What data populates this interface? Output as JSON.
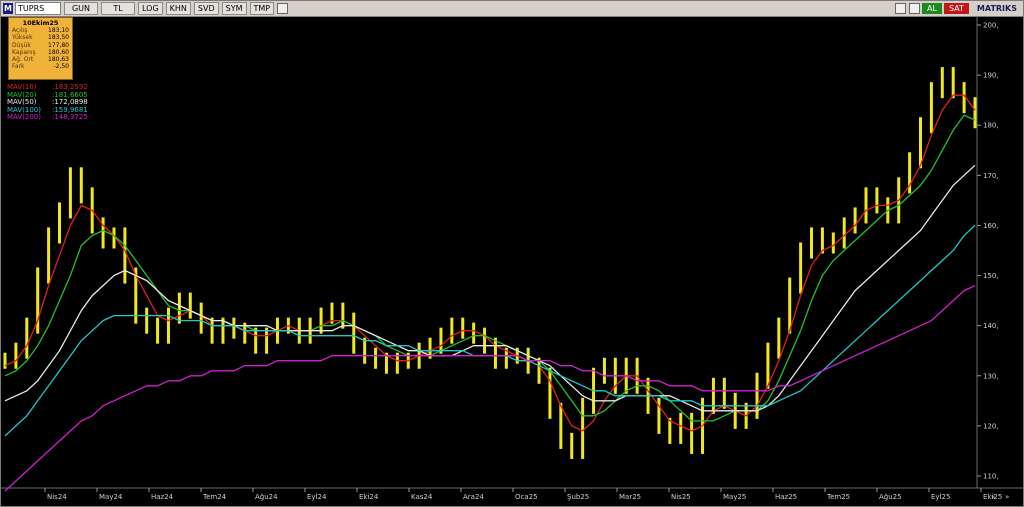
{
  "toolbar": {
    "logo": "M",
    "symbol": "TUPRS",
    "buttons": [
      "GUN",
      "TL",
      "LOG",
      "KHN",
      "SVD",
      "SYM",
      "TMP"
    ],
    "buy": "AL",
    "sell": "SAT",
    "brand": "MATRIKS"
  },
  "info": {
    "date": "10Ekim25",
    "rows": [
      {
        "label": "Açılış",
        "value": "183,10"
      },
      {
        "label": "Yüksek",
        "value": "183,50"
      },
      {
        "label": "Düşük",
        "value": "177,80"
      },
      {
        "label": "Kapanış",
        "value": "180,60"
      },
      {
        "label": "Ağ. Ort",
        "value": "180,63"
      },
      {
        "label": "Fark",
        "value": "-2,50"
      }
    ]
  },
  "mav": [
    {
      "label": "MAV(10)",
      "value": ":183,2592",
      "color": "#e02020"
    },
    {
      "label": "MAV(20)",
      "value": ":181,6605",
      "color": "#22c22a"
    },
    {
      "label": "MAV(50)",
      "value": ":172,0898",
      "color": "#e8e8e8"
    },
    {
      "label": "MAV(100)",
      "value": ":159,9681",
      "color": "#20c8c8"
    },
    {
      "label": "MAV(200)",
      "value": ":148,3725",
      "color": "#d020d0"
    }
  ],
  "chart_data": {
    "type": "line",
    "xticks": [
      "Nis24",
      "May24",
      "Haz24",
      "Tem24",
      "Ağu24",
      "Eyl24",
      "Eki24",
      "Kas24",
      "Ara24",
      "Oca25",
      "Şub25",
      "Mar25",
      "Nis25",
      "May25",
      "Haz25",
      "Tem25",
      "Ağu25",
      "Eyl25",
      "Eki25"
    ],
    "yticks": [
      "200,",
      "190,",
      "180,",
      "170,",
      "160,",
      "150,",
      "140,",
      "130,",
      "120,",
      "110,"
    ],
    "ylim": [
      108,
      201
    ],
    "price": [
      133,
      135,
      140,
      150,
      158,
      163,
      170,
      166,
      160,
      157,
      158,
      150,
      142,
      140,
      138,
      142,
      145,
      143,
      140,
      138,
      140,
      139,
      138,
      136,
      138,
      140,
      140,
      138,
      140,
      142,
      143,
      141,
      136,
      134,
      133,
      132,
      133,
      133,
      135,
      136,
      138,
      140,
      139,
      138,
      136,
      133,
      134,
      134,
      132,
      130,
      123,
      117,
      115,
      124,
      130,
      132,
      128,
      132,
      128,
      124,
      120,
      118,
      121,
      116,
      124,
      128,
      125,
      121,
      123,
      129,
      135,
      140,
      148,
      155,
      158,
      156,
      157,
      160,
      162,
      166,
      164,
      162,
      168,
      173,
      180,
      187,
      190,
      187,
      184,
      181
    ],
    "price_color": "#f0e818",
    "series": [
      {
        "name": "MAV(10)",
        "color": "#e02020",
        "values": [
          132,
          133,
          136,
          141,
          148,
          154,
          160,
          164,
          163,
          160,
          158,
          155,
          150,
          146,
          142,
          141,
          142,
          143,
          142,
          140,
          140,
          140,
          139,
          138,
          138,
          139,
          140,
          139,
          139,
          140,
          141,
          141,
          140,
          138,
          136,
          134,
          133,
          133,
          134,
          135,
          136,
          138,
          139,
          139,
          138,
          136,
          135,
          134,
          133,
          132,
          129,
          124,
          120,
          119,
          121,
          125,
          128,
          130,
          130,
          127,
          124,
          121,
          120,
          119,
          120,
          123,
          124,
          123,
          122,
          124,
          128,
          133,
          139,
          146,
          152,
          155,
          156,
          158,
          160,
          163,
          164,
          164,
          165,
          168,
          172,
          178,
          183,
          186,
          186,
          183
        ]
      },
      {
        "name": "MAV(20)",
        "color": "#22c22a",
        "values": [
          130,
          131,
          133,
          136,
          140,
          145,
          150,
          156,
          158,
          159,
          158,
          156,
          153,
          150,
          147,
          144,
          143,
          143,
          142,
          141,
          141,
          140,
          140,
          139,
          139,
          139,
          139,
          139,
          139,
          140,
          140,
          141,
          140,
          139,
          138,
          136,
          135,
          134,
          134,
          134,
          135,
          136,
          137,
          138,
          138,
          137,
          136,
          135,
          134,
          133,
          131,
          128,
          125,
          122,
          122,
          123,
          125,
          127,
          128,
          128,
          127,
          125,
          123,
          121,
          121,
          121,
          122,
          123,
          123,
          123,
          125,
          129,
          134,
          139,
          145,
          150,
          153,
          155,
          157,
          159,
          161,
          163,
          164,
          166,
          168,
          171,
          175,
          179,
          182,
          181
        ]
      },
      {
        "name": "MAV(50)",
        "color": "#e8e8e8",
        "values": [
          125,
          126,
          127,
          129,
          132,
          135,
          139,
          143,
          146,
          148,
          150,
          151,
          150,
          149,
          147,
          145,
          144,
          143,
          142,
          141,
          141,
          140,
          140,
          140,
          140,
          139,
          139,
          139,
          139,
          139,
          139,
          140,
          140,
          139,
          138,
          137,
          136,
          135,
          135,
          134,
          134,
          134,
          135,
          136,
          136,
          136,
          136,
          135,
          134,
          133,
          132,
          130,
          128,
          126,
          125,
          125,
          125,
          126,
          126,
          126,
          126,
          126,
          125,
          124,
          123,
          123,
          123,
          123,
          123,
          123,
          124,
          126,
          129,
          132,
          135,
          138,
          141,
          144,
          147,
          149,
          151,
          153,
          155,
          157,
          159,
          162,
          165,
          168,
          170,
          172
        ]
      },
      {
        "name": "MAV(100)",
        "color": "#20c8c8",
        "values": [
          118,
          120,
          122,
          125,
          128,
          131,
          134,
          137,
          139,
          141,
          142,
          142,
          142,
          142,
          142,
          142,
          141,
          141,
          141,
          140,
          140,
          140,
          139,
          139,
          139,
          139,
          139,
          138,
          138,
          138,
          138,
          138,
          138,
          137,
          137,
          136,
          136,
          136,
          135,
          135,
          135,
          135,
          135,
          134,
          134,
          134,
          134,
          133,
          133,
          132,
          131,
          130,
          129,
          128,
          127,
          127,
          126,
          126,
          126,
          126,
          126,
          125,
          125,
          125,
          124,
          124,
          124,
          124,
          124,
          124,
          124,
          125,
          126,
          127,
          129,
          131,
          133,
          135,
          137,
          139,
          141,
          143,
          145,
          147,
          149,
          151,
          153,
          155,
          158,
          160
        ]
      },
      {
        "name": "MAV(200)",
        "color": "#d020d0",
        "values": [
          107,
          109,
          111,
          113,
          115,
          117,
          119,
          121,
          122,
          124,
          125,
          126,
          127,
          128,
          128,
          129,
          129,
          130,
          130,
          131,
          131,
          131,
          132,
          132,
          132,
          133,
          133,
          133,
          133,
          133,
          134,
          134,
          134,
          134,
          134,
          134,
          134,
          134,
          134,
          134,
          134,
          134,
          134,
          134,
          134,
          134,
          134,
          134,
          133,
          133,
          133,
          132,
          132,
          131,
          131,
          130,
          130,
          130,
          129,
          129,
          129,
          128,
          128,
          128,
          127,
          127,
          127,
          127,
          127,
          127,
          127,
          128,
          128,
          129,
          130,
          131,
          132,
          133,
          134,
          135,
          136,
          137,
          138,
          139,
          140,
          141,
          143,
          145,
          147,
          148
        ]
      }
    ]
  }
}
